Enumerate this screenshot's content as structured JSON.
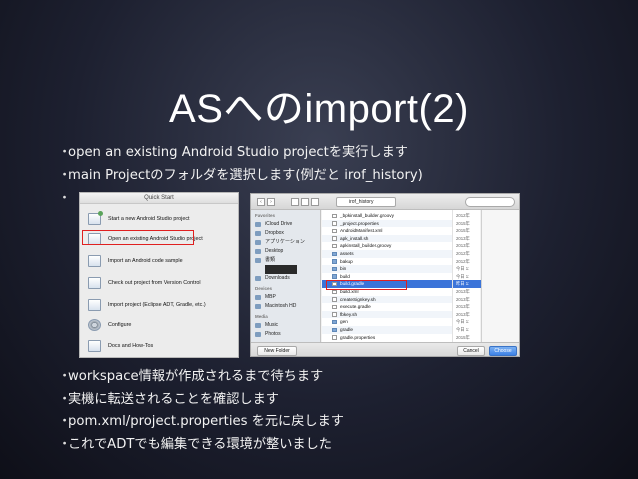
{
  "slide": {
    "title": "ASへのimport(2)",
    "bullet_marker": "・",
    "bullets_top": [
      "open an existing Android Studio projectを実行します",
      "main Projectのフォルダを選択します(例だと irof_history)"
    ],
    "bullets_bottom": [
      "workspace情報が作成されるまで待ちます",
      "実機に転送されることを確認します",
      "pom.xml/project.properties を元に戻します",
      "これでADTでも編集できる環境が整いました"
    ]
  },
  "quick_start": {
    "title": "Quick Start",
    "items": [
      {
        "label": "Start a new Android Studio project",
        "icon": "new-project-icon"
      },
      {
        "label": "Open an existing Android Studio project",
        "icon": "open-folder-icon"
      },
      {
        "label": "Import an Android code sample",
        "icon": "sample-icon"
      },
      {
        "label": "Check out project from Version Control",
        "icon": "vcs-icon"
      },
      {
        "label": "Import project (Eclipse ADT, Gradle, etc.)",
        "icon": "import-icon"
      },
      {
        "label": "Configure",
        "icon": "gear-icon"
      },
      {
        "label": "Docs and How-Tos",
        "icon": "docs-icon"
      }
    ],
    "highlighted_index": 1,
    "highlight_color": "#e02020"
  },
  "file_chooser": {
    "path": "irof_history",
    "sidebar": {
      "favorites_head": "Favorites",
      "favorites": [
        "iCloud Drive",
        "Dropbox",
        "アプリケーション",
        "Desktop",
        "書類",
        "",
        "Downloads"
      ],
      "devices_head": "Devices",
      "devices": [
        "MBP",
        "Macintosh HD"
      ],
      "media_head": "Media",
      "media": [
        "Music",
        "Photos"
      ]
    },
    "files": [
      {
        "name": "_bpkinstall_builder.groovy",
        "type": "file",
        "date": "2012年"
      },
      {
        "name": "_project.properties",
        "type": "file",
        "date": "2015年"
      },
      {
        "name": "AndroidManifest.xml",
        "type": "file",
        "date": "2015年"
      },
      {
        "name": "apk_install.sh",
        "type": "file",
        "date": "2013年"
      },
      {
        "name": "apkinstall_builder.groovy",
        "type": "file",
        "date": "2013年"
      },
      {
        "name": "assets",
        "type": "folder",
        "date": "2012年"
      },
      {
        "name": "bakup",
        "type": "folder",
        "date": "2012年"
      },
      {
        "name": "bin",
        "type": "folder",
        "date": "今日 1:"
      },
      {
        "name": "build",
        "type": "folder",
        "date": "今日 1:"
      },
      {
        "name": "build.gradle",
        "type": "file",
        "date": "昨日 1:",
        "selected": true
      },
      {
        "name": "build.xml",
        "type": "file",
        "date": "2013年"
      },
      {
        "name": "createSignkey.sh",
        "type": "file",
        "date": "2013年"
      },
      {
        "name": "execute.gradle",
        "type": "file",
        "date": "2013年"
      },
      {
        "name": "fbkey.sh",
        "type": "file",
        "date": "2013年"
      },
      {
        "name": "gen",
        "type": "folder",
        "date": "今日 1:"
      },
      {
        "name": "gradle",
        "type": "folder",
        "date": "今日 1:"
      },
      {
        "name": "gradle.properties",
        "type": "file",
        "date": "2015年"
      }
    ],
    "new_folder_label": "New Folder",
    "cancel_label": "Cancel",
    "choose_label": "Choose"
  }
}
